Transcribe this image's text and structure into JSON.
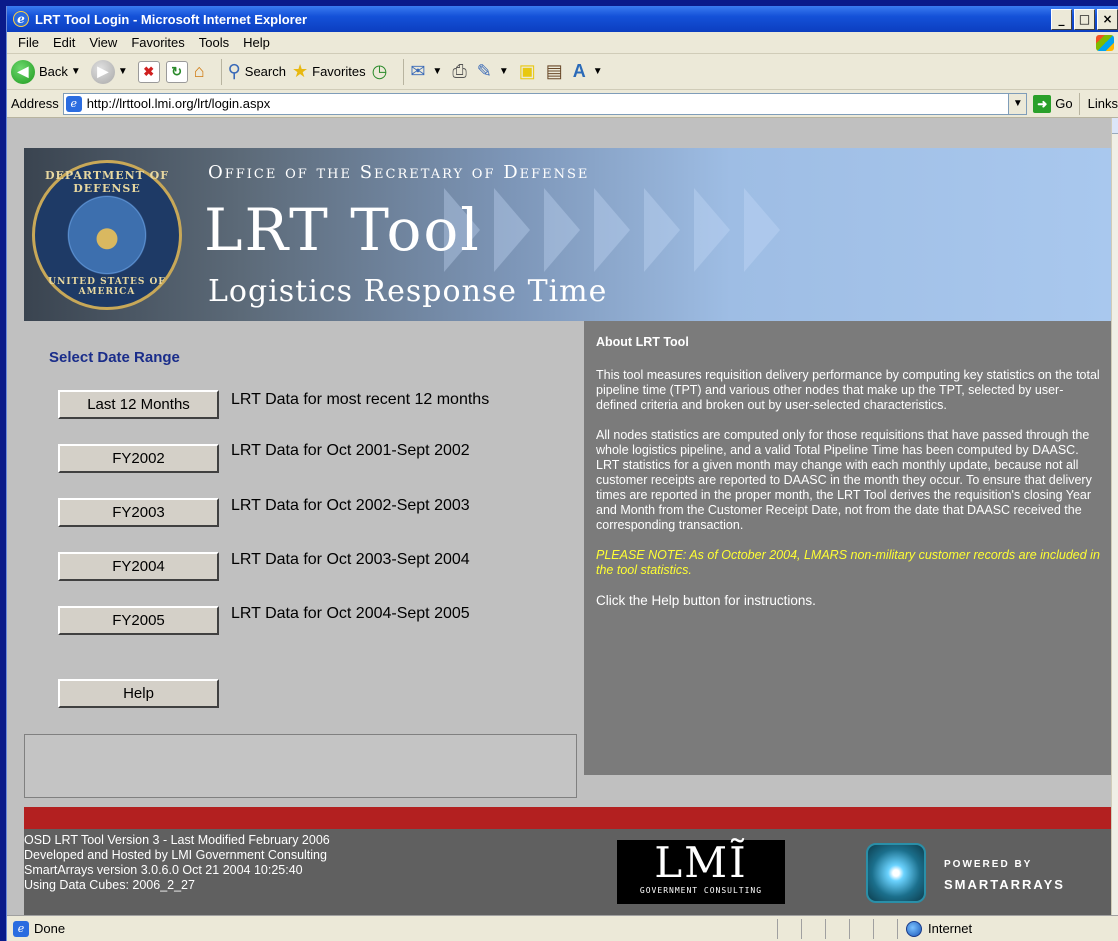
{
  "window": {
    "title": "LRT Tool Login - Microsoft Internet Explorer",
    "controls": [
      "_",
      "□",
      "×"
    ]
  },
  "menu": [
    "File",
    "Edit",
    "View",
    "Favorites",
    "Tools",
    "Help"
  ],
  "toolbar": {
    "back_label": "Back",
    "search_label": "Search",
    "favorites_label": "Favorites"
  },
  "address": {
    "label": "Address",
    "url": "http://lrttool.lmi.org/lrt/login.aspx",
    "go_label": "Go",
    "links_label": "Links"
  },
  "banner": {
    "subtitle": "Office of the Secretary of Defense",
    "title": "LRT Tool",
    "tagline": "Logistics Response Time",
    "seal_top": "DEPARTMENT OF DEFENSE",
    "seal_bottom": "UNITED STATES OF AMERICA"
  },
  "date_range": {
    "heading": "Select Date Range",
    "options": [
      {
        "label": "Last 12 Months",
        "desc": "LRT Data for most recent 12 months"
      },
      {
        "label": "FY2002",
        "desc": "LRT Data for Oct 2001-Sept 2002"
      },
      {
        "label": "FY2003",
        "desc": "LRT Data for Oct 2002-Sept 2003"
      },
      {
        "label": "FY2004",
        "desc": "LRT Data for Oct 2003-Sept 2004"
      },
      {
        "label": "FY2005",
        "desc": "LRT Data for Oct 2004-Sept 2005"
      }
    ],
    "help_label": "Help"
  },
  "about": {
    "title": "About LRT Tool",
    "para1": "This tool measures requisition delivery performance by computing key statistics on the total pipeline time (TPT) and various other nodes that make up the TPT, selected by user-defined criteria and broken out by user-selected characteristics.",
    "para2": "All nodes statistics are computed only for those requisitions that have passed through the whole logistics pipeline, and a valid Total Pipeline Time has been computed by DAASC. LRT statistics for a given month may change with each monthly update, because not all customer receipts are reported to DAASC in the month they occur.  To ensure that delivery times are reported in the proper month, the LRT Tool derives the requisition's closing Year and Month from the Customer Receipt Date, not from the date that DAASC received the corresponding transaction.",
    "note": "PLEASE NOTE: As of October 2004, LMARS non-military customer records are included in the tool statistics.",
    "help_line": "Click the Help button for instructions."
  },
  "footer": {
    "line1": "OSD LRT Tool Version 3 - Last Modified February 2006",
    "line2": "Developed and Hosted by LMI Government Consulting",
    "line3": "SmartArrays version 3.0.6.0 Oct 21 2004 10:25:40",
    "line4": "Using Data Cubes: 2006_2_27",
    "lmi_logo": "LMĨ",
    "lmi_sub": "GOVERNMENT CONSULTING",
    "powered_by": "POWERED BY",
    "smartarrays": "SMARTARRAYS"
  },
  "status": {
    "text": "Done",
    "zone": "Internet"
  },
  "colors": {
    "heading_blue": "#1a2d8a",
    "about_bg": "#7b7b7b",
    "note_yellow": "#ffff33",
    "footer_red": "#b32020",
    "footer_bg": "#606060"
  }
}
